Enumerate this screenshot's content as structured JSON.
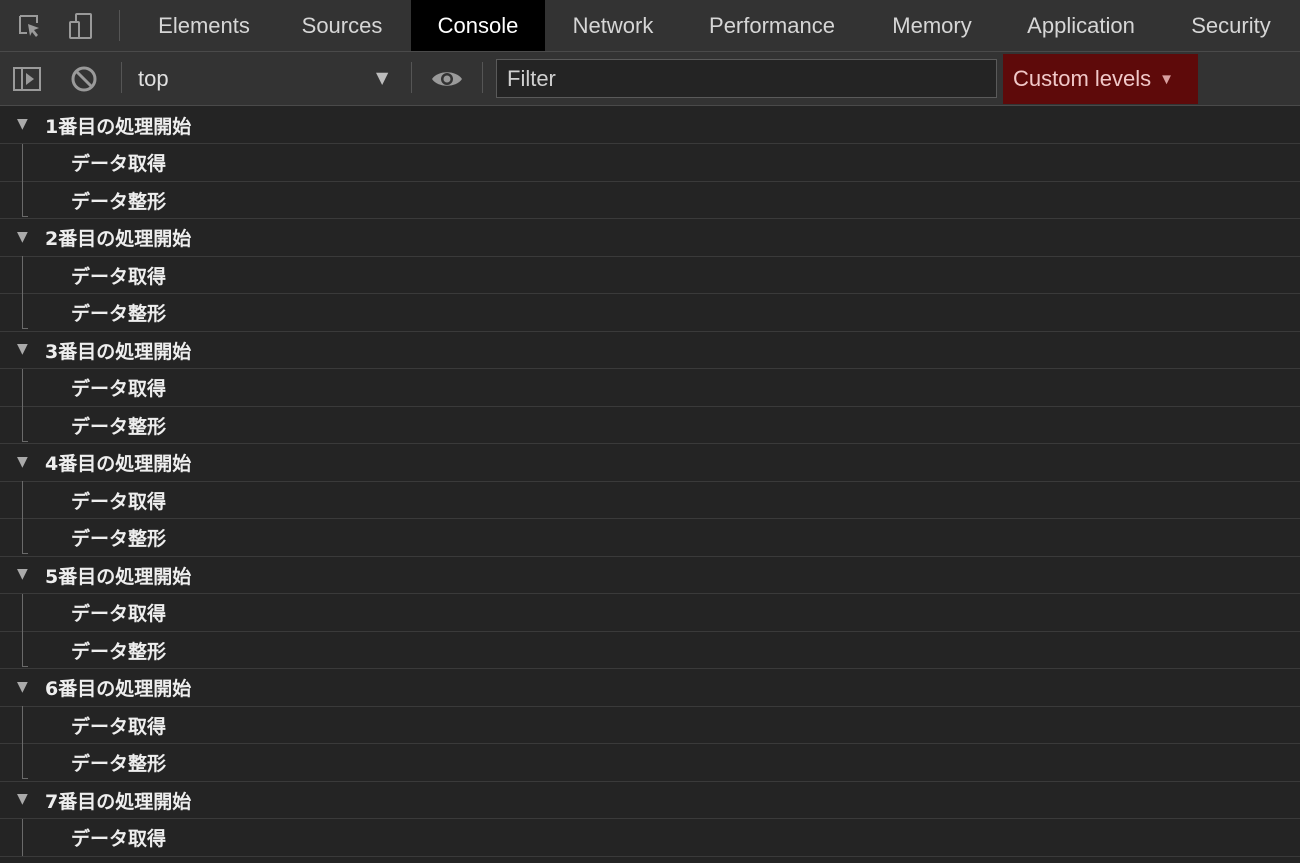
{
  "devtools": {
    "tabs": [
      "Elements",
      "Sources",
      "Console",
      "Network",
      "Performance",
      "Memory",
      "Application",
      "Security"
    ],
    "active_tab": "Console",
    "icons": {
      "inspect": "inspect-element-icon",
      "device": "device-toolbar-icon",
      "sidebar": "show-sidebar-icon",
      "clear": "clear-console-icon",
      "eye": "live-expression-icon"
    }
  },
  "toolbar": {
    "context": "top",
    "filter_placeholder": "Filter",
    "levels_label": "Custom levels",
    "levels_color": "#5e0a0a"
  },
  "console": {
    "groups": [
      {
        "label": "1番目の処理開始",
        "children": [
          "データ取得",
          "データ整形"
        ]
      },
      {
        "label": "2番目の処理開始",
        "children": [
          "データ取得",
          "データ整形"
        ]
      },
      {
        "label": "3番目の処理開始",
        "children": [
          "データ取得",
          "データ整形"
        ]
      },
      {
        "label": "4番目の処理開始",
        "children": [
          "データ取得",
          "データ整形"
        ]
      },
      {
        "label": "5番目の処理開始",
        "children": [
          "データ取得",
          "データ整形"
        ]
      },
      {
        "label": "6番目の処理開始",
        "children": [
          "データ取得",
          "データ整形"
        ]
      },
      {
        "label": "7番目の処理開始",
        "children": [
          "データ取得"
        ]
      }
    ]
  }
}
